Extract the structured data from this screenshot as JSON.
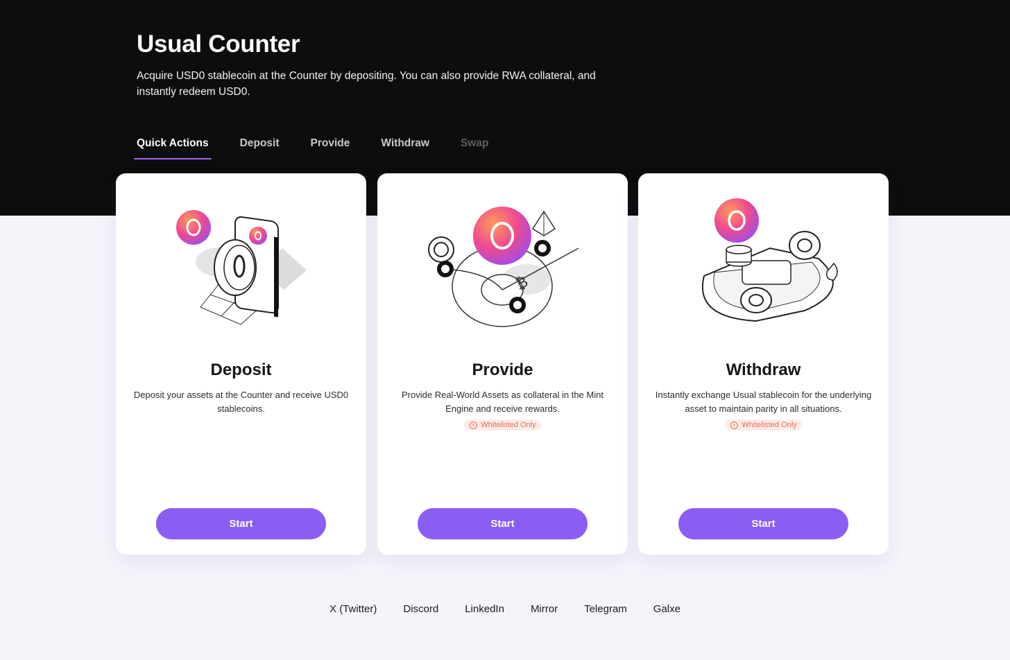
{
  "header": {
    "title": "Usual Counter",
    "subtitle": "Acquire USD0 stablecoin at the Counter by depositing. You can also provide RWA collateral, and instantly redeem USD0."
  },
  "tabs": [
    {
      "label": "Quick Actions",
      "state": "active"
    },
    {
      "label": "Deposit",
      "state": "normal"
    },
    {
      "label": "Provide",
      "state": "normal"
    },
    {
      "label": "Withdraw",
      "state": "normal"
    },
    {
      "label": "Swap",
      "state": "disabled"
    }
  ],
  "cards": [
    {
      "title": "Deposit",
      "description": "Deposit your assets at the Counter and receive USD0 stablecoins.",
      "badge": "",
      "button": "Start",
      "illustration": "deposit-illustration"
    },
    {
      "title": "Provide",
      "description": "Provide Real-World Assets as collateral in the Mint Engine and receive rewards.",
      "badge": "Whitelisted Only",
      "button": "Start",
      "illustration": "provide-illustration"
    },
    {
      "title": "Withdraw",
      "description": "Instantly exchange Usual stablecoin for the underlying asset to maintain parity in all situations.",
      "badge": "Whitelisted Only",
      "button": "Start",
      "illustration": "withdraw-illustration"
    }
  ],
  "footer": {
    "links": [
      "X (Twitter)",
      "Discord",
      "LinkedIn",
      "Mirror",
      "Telegram",
      "Galxe"
    ]
  },
  "colors": {
    "hero_bg": "#0d0d0d",
    "page_bg": "#f5f4fb",
    "accent": "#8b5ef3",
    "tab_underline": "#a265f3",
    "badge_bg": "#fdecea",
    "badge_text": "#e66c4c",
    "coin_gradient": [
      "#f04a8c",
      "#c057e8",
      "#ff8a4c"
    ]
  }
}
